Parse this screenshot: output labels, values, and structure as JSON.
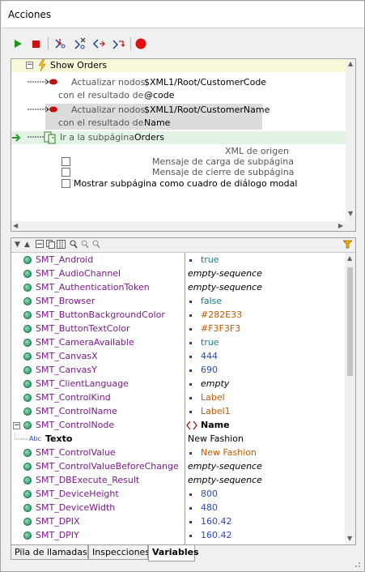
{
  "window": {
    "title": "Acciones"
  },
  "toolbar": {
    "buttons": [
      {
        "icon": "play-icon",
        "color": "#1a9a1a"
      },
      {
        "icon": "stop-icon",
        "color": "#cc1111"
      },
      {
        "icon": "step-into-icon"
      },
      {
        "icon": "step-over-icon"
      },
      {
        "icon": "step-out-icon"
      },
      {
        "icon": "step-back-icon"
      },
      {
        "icon": "breakpoint-icon",
        "color": "#e01010"
      }
    ]
  },
  "actions": {
    "root_label": "Show Orders",
    "update1": {
      "action": "Actualizar nodos",
      "path": "$XML1/Root/CustomerCode",
      "result_label": "con el resultado de",
      "result": "@code"
    },
    "update2": {
      "action": "Actualizar nodos",
      "path": "$XML1/Root/CustomerName",
      "result_label": "con el resultado de",
      "result": "Name"
    },
    "goto": {
      "action": "Ir a la subpágina",
      "target": "Orders"
    },
    "options": {
      "source_xml": "XML de origen",
      "load_msg": "Mensaje de carga de subpágina",
      "close_msg": "Mensaje de cierre de subpágina",
      "modal": "Mostrar subpágina como cuadro de diálogo modal"
    }
  },
  "variables": [
    {
      "name": "SMT_Android",
      "value": "true",
      "kind": "teal",
      "bullet": true
    },
    {
      "name": "SMT_AudioChannel",
      "value": "empty-sequence",
      "kind": "italic",
      "bullet": false
    },
    {
      "name": "SMT_AuthenticationToken",
      "value": "empty-sequence",
      "kind": "italic",
      "bullet": false
    },
    {
      "name": "SMT_Browser",
      "value": "false",
      "kind": "teal",
      "bullet": true
    },
    {
      "name": "SMT_ButtonBackgroundColor",
      "value": "#282E33",
      "kind": "orange",
      "bullet": true
    },
    {
      "name": "SMT_ButtonTextColor",
      "value": "#F3F3F3",
      "kind": "orange",
      "bullet": true
    },
    {
      "name": "SMT_CameraAvailable",
      "value": "true",
      "kind": "teal",
      "bullet": true
    },
    {
      "name": "SMT_CanvasX",
      "value": "444",
      "kind": "blue",
      "bullet": true
    },
    {
      "name": "SMT_CanvasY",
      "value": "690",
      "kind": "blue",
      "bullet": true
    },
    {
      "name": "SMT_ClientLanguage",
      "value": "empty",
      "kind": "italic",
      "bullet": true
    },
    {
      "name": "SMT_ControlKind",
      "value": "Label",
      "kind": "orange",
      "bullet": true
    },
    {
      "name": "SMT_ControlName",
      "value": "Label1",
      "kind": "orange",
      "bullet": true
    },
    {
      "name": "SMT_ControlNode",
      "value": "Name",
      "kind": "element",
      "bullet": false
    },
    {
      "name": "Texto",
      "value": "New Fashion",
      "kind": "text",
      "bullet": false
    },
    {
      "name": "SMT_ControlValue",
      "value": "New Fashion",
      "kind": "orange",
      "bullet": true
    },
    {
      "name": "SMT_ControlValueBeforeChange",
      "value": "empty-sequence",
      "kind": "italic",
      "bullet": false
    },
    {
      "name": "SMT_DBExecute_Result",
      "value": "empty-sequence",
      "kind": "italic",
      "bullet": false
    },
    {
      "name": "SMT_DeviceHeight",
      "value": "800",
      "kind": "blue",
      "bullet": true
    },
    {
      "name": "SMT_DeviceWidth",
      "value": "480",
      "kind": "blue",
      "bullet": true
    },
    {
      "name": "SMT_DPIX",
      "value": "160.42",
      "kind": "blue",
      "bullet": true
    },
    {
      "name": "SMT_DPIY",
      "value": "160.42",
      "kind": "blue",
      "bullet": true
    }
  ],
  "abc_label": "Abc",
  "tabs": [
    "Pila de llamadas",
    "Inspecciones",
    "Variables"
  ],
  "active_tab": "Variables"
}
